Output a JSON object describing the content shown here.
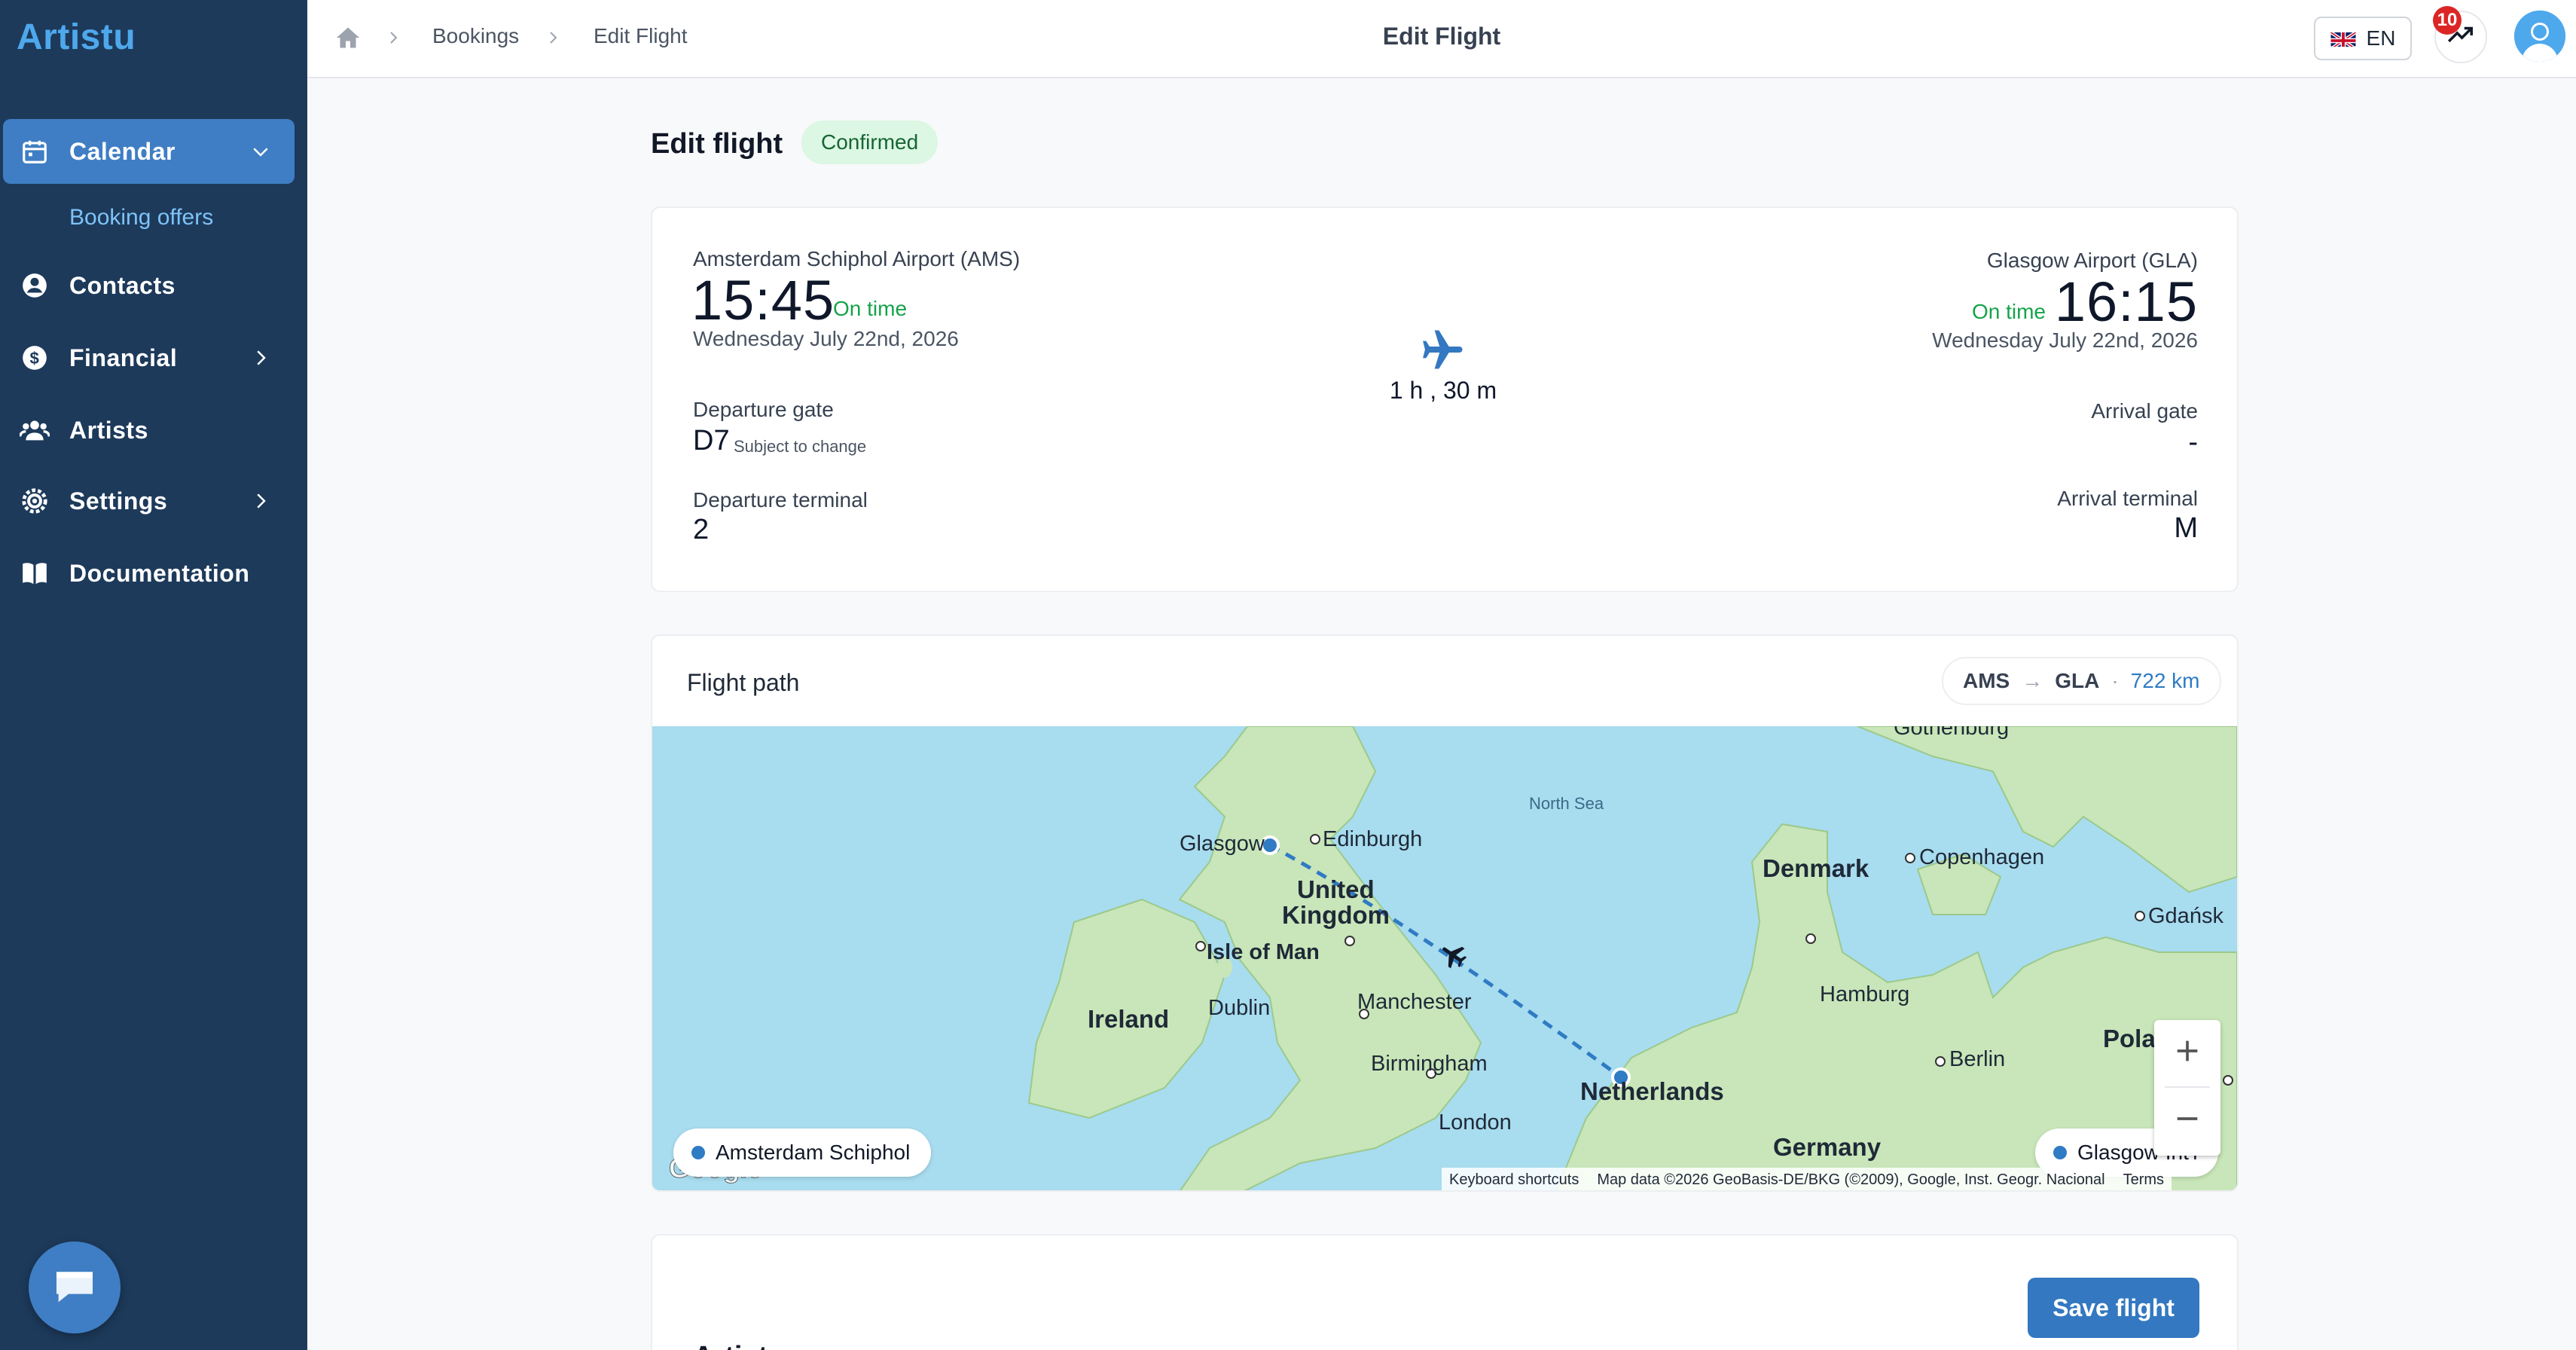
{
  "app": {
    "name": "Artistu"
  },
  "sidebar": {
    "items": [
      {
        "label": "Calendar",
        "icon": "calendar-icon",
        "active": true,
        "expanded": true
      },
      {
        "label": "Contacts",
        "icon": "user-circle-icon"
      },
      {
        "label": "Financial",
        "icon": "dollar-icon",
        "has_children": true
      },
      {
        "label": "Artists",
        "icon": "users-icon"
      },
      {
        "label": "Settings",
        "icon": "gear-icon",
        "has_children": true
      },
      {
        "label": "Documentation",
        "icon": "book-icon"
      }
    ],
    "sub_items": [
      {
        "label": "Booking offers"
      }
    ]
  },
  "topbar": {
    "breadcrumb": [
      "Bookings",
      "Edit Flight"
    ],
    "title": "Edit Flight",
    "language": "EN",
    "notifications": "10"
  },
  "page": {
    "heading": "Edit flight",
    "status": "Confirmed"
  },
  "flight": {
    "departure": {
      "airport": "Amsterdam Schiphol Airport (AMS)",
      "time": "15:45",
      "status": "On time",
      "date": "Wednesday July 22nd, 2026",
      "gate_label": "Departure gate",
      "gate": "D7",
      "gate_note": "Subject to change",
      "terminal_label": "Departure terminal",
      "terminal": "2"
    },
    "arrival": {
      "airport": "Glasgow Airport (GLA)",
      "time": "16:15",
      "status": "On time",
      "date": "Wednesday July 22nd, 2026",
      "gate_label": "Arrival gate",
      "gate": "-",
      "terminal_label": "Arrival terminal",
      "terminal": "M"
    },
    "duration": "1 h , 30 m"
  },
  "flight_path": {
    "title": "Flight path",
    "from": "AMS",
    "to": "GLA",
    "distance": "722 km",
    "origin_pill": "Amsterdam Schiphol",
    "destination_pill": "Glasgow Int'l",
    "map_labels": {
      "north_sea": "North Sea",
      "glasgow": "Glasgow",
      "edinburgh": "Edinburgh",
      "uk_1": "United",
      "uk_2": "Kingdom",
      "isle_of_man": "Isle of Man",
      "ireland": "Ireland",
      "dublin": "Dublin",
      "manchester": "Manchester",
      "birmingham": "Birmingham",
      "london": "London",
      "netherlands": "Netherlands",
      "germany": "Germany",
      "denmark": "Denmark",
      "copenhagen": "Copenhagen",
      "hamburg": "Hamburg",
      "berlin": "Berlin",
      "gdansk": "Gdańsk",
      "poland": "Pola",
      "gothenburg": "Gothenburg"
    },
    "attribution": {
      "shortcuts": "Keyboard shortcuts",
      "data": "Map data ©2026 GeoBasis-DE/BKG (©2009), Google, Inst. Geogr. Nacional",
      "terms": "Terms"
    },
    "google": "Google"
  },
  "actions": {
    "save": "Save flight",
    "next_section": "Artist"
  },
  "colors": {
    "sidebar": "#1d3a5b",
    "accent": "#3378c1",
    "on_time": "#16a34a",
    "badge_bg": "#dcf7e3",
    "water": "#a8dcef",
    "land": "#c8e6b9"
  }
}
